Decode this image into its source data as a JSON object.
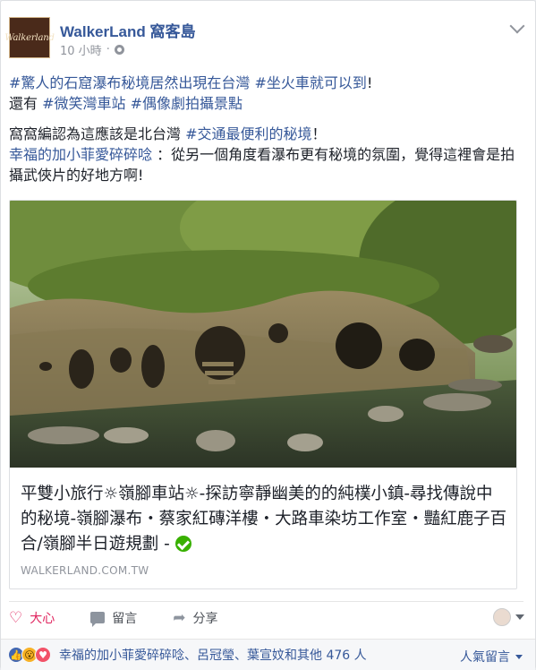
{
  "header": {
    "avatar_text": "Walkerland",
    "page_name": "WalkerLand 窩客島",
    "timestamp": "10 小時",
    "separator": "·"
  },
  "post": {
    "line1_tag_a": "#驚人的石窟瀑布秘境居然出現在台灣",
    "line1_tag_b": "#坐火車就可以到",
    "line1_end": "!",
    "line2_prefix": "還有 ",
    "line2_tag_a": "#微笑灣車站",
    "line2_tag_b": "#偶像劇拍攝景點",
    "p2_prefix": "窩窩編認為這應該是北台灣 ",
    "p2_tag": "#交通最便利的秘境",
    "p2_end": "！",
    "p3_mention": "幸福的加小菲愛碎碎唸",
    "p3_text": " ：從另一個角度看瀑布更有秘境的氛圍，覺得這裡會是拍攝武俠片的好地方啊!"
  },
  "link": {
    "title": "平雙小旅行☼嶺腳車站☼-探訪寧靜幽美的的純樸小鎮-尋找傳說中的秘境-嶺腳瀑布・蔡家紅磚洋樓・大路車染坊工作室・豔紅鹿子百合/嶺腳半日遊規劃 -",
    "domain": "WALKERLAND.COM.TW"
  },
  "actions": {
    "love_label": "大心",
    "comment_label": "留言",
    "share_label": "分享"
  },
  "reactions": {
    "summary": "幸福的加小菲愛碎碎唸、呂冠瑩、葉宣妏和其他 476 人",
    "top_comments_label": "人氣留言"
  },
  "colors": {
    "link_blue": "#365899",
    "love_red": "#e0245e",
    "card_bg": "#ffffff"
  }
}
